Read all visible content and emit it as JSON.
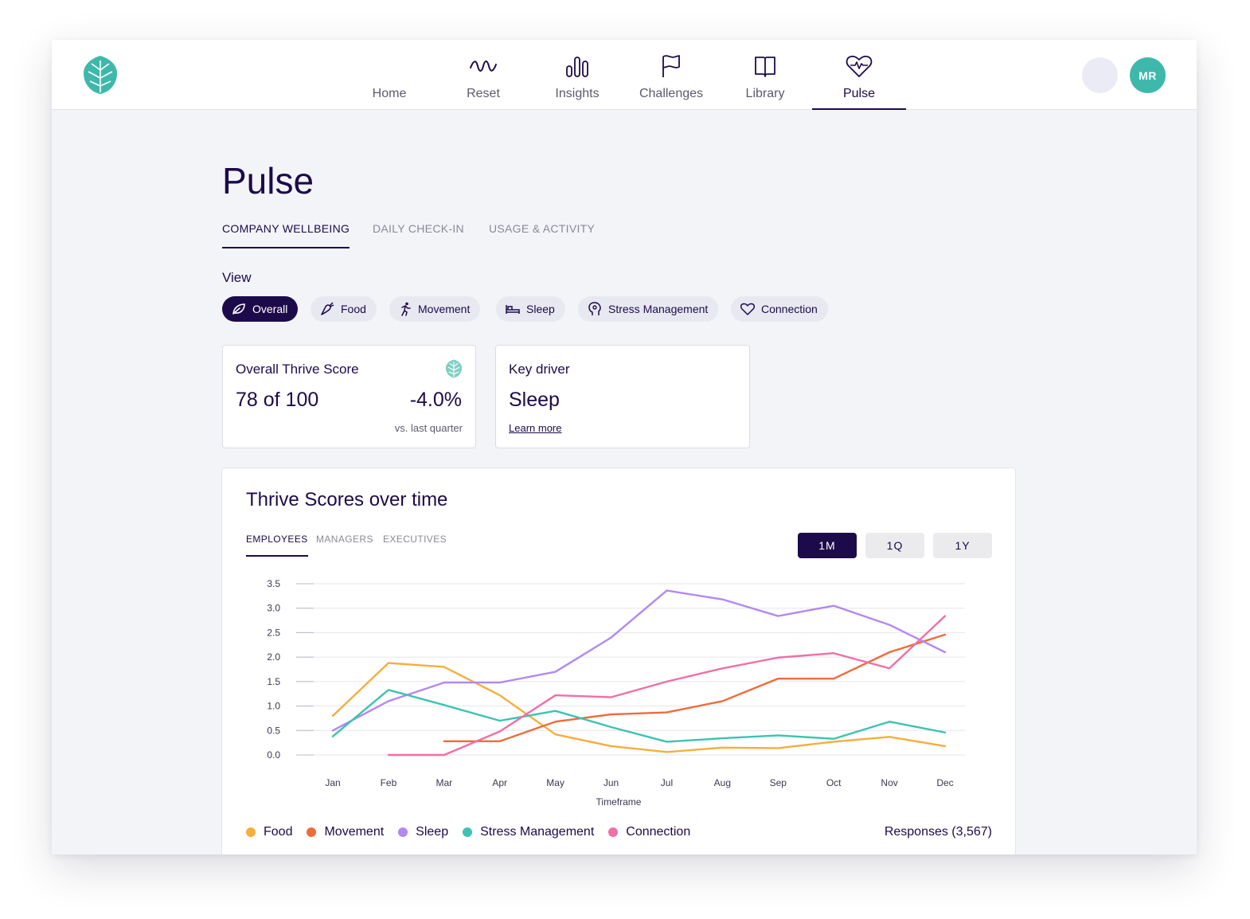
{
  "nav": {
    "items": [
      {
        "label": "Home",
        "icon": "home-icon"
      },
      {
        "label": "Reset",
        "icon": "wave-icon"
      },
      {
        "label": "Insights",
        "icon": "bar-chart-icon"
      },
      {
        "label": "Challenges",
        "icon": "flag-icon"
      },
      {
        "label": "Library",
        "icon": "book-icon"
      },
      {
        "label": "Pulse",
        "icon": "heart-pulse-icon"
      }
    ],
    "active": "Pulse",
    "avatar_initials": "MR"
  },
  "page": {
    "title": "Pulse",
    "tabs": [
      "COMPANY WELLBEING",
      "DAILY CHECK-IN",
      "USAGE & ACTIVITY"
    ],
    "active_tab": "COMPANY WELLBEING"
  },
  "view": {
    "label": "View",
    "chips": [
      "Overall",
      "Food",
      "Movement",
      "Sleep",
      "Stress Management",
      "Connection"
    ],
    "active": "Overall"
  },
  "score_card": {
    "title": "Overall Thrive Score",
    "score": "78 of 100",
    "delta": "-4.0%",
    "comparison": "vs. last quarter"
  },
  "driver_card": {
    "title": "Key driver",
    "value": "Sleep",
    "link": "Learn more"
  },
  "chart_panel": {
    "title": "Thrive Scores over time",
    "tabs": [
      "EMPLOYEES",
      "MANAGERS",
      "EXECUTIVES"
    ],
    "active_tab": "EMPLOYEES",
    "ranges": [
      "1M",
      "1Q",
      "1Y"
    ],
    "active_range": "1M",
    "responses": "Responses (3,567)"
  },
  "colors": {
    "brand_dark": "#1d0a4a",
    "teal": "#3fb8ac",
    "Food": "#f7ae3b",
    "Movement": "#ef6b3a",
    "Sleep": "#b388f0",
    "Stress Management": "#3cc3b2",
    "Connection": "#f06fa5"
  },
  "chart_data": {
    "type": "line",
    "title": "Thrive Scores over time",
    "xlabel": "Timeframe",
    "ylabel": "",
    "categories": [
      "Jan",
      "Feb",
      "Mar",
      "Apr",
      "May",
      "Jun",
      "Jul",
      "Aug",
      "Sep",
      "Oct",
      "Nov",
      "Dec"
    ],
    "yticks": [
      "0.0",
      "0.5",
      "1.0",
      "1.5",
      "2.0",
      "2.5",
      "3.0",
      "3.5"
    ],
    "ylim": [
      0,
      3.5
    ],
    "grid": true,
    "legend_position": "bottom-left",
    "series": [
      {
        "name": "Food",
        "values": [
          0.8,
          1.88,
          1.8,
          1.22,
          0.42,
          0.18,
          0.06,
          0.15,
          0.14,
          0.27,
          0.37,
          0.18
        ]
      },
      {
        "name": "Movement",
        "values": [
          null,
          null,
          0.28,
          0.28,
          0.68,
          0.83,
          0.87,
          1.1,
          1.56,
          1.56,
          2.1,
          2.46
        ]
      },
      {
        "name": "Sleep",
        "values": [
          0.5,
          1.1,
          1.48,
          1.48,
          1.7,
          2.4,
          3.36,
          3.18,
          2.84,
          3.05,
          2.66,
          2.1
        ]
      },
      {
        "name": "Stress Management",
        "values": [
          0.38,
          1.33,
          1.02,
          0.7,
          0.9,
          0.57,
          0.27,
          0.34,
          0.4,
          0.33,
          0.68,
          0.46
        ]
      },
      {
        "name": "Connection",
        "values": [
          null,
          0.0,
          0.0,
          0.48,
          1.22,
          1.18,
          1.5,
          1.77,
          1.99,
          2.08,
          1.77,
          2.84
        ]
      }
    ]
  }
}
